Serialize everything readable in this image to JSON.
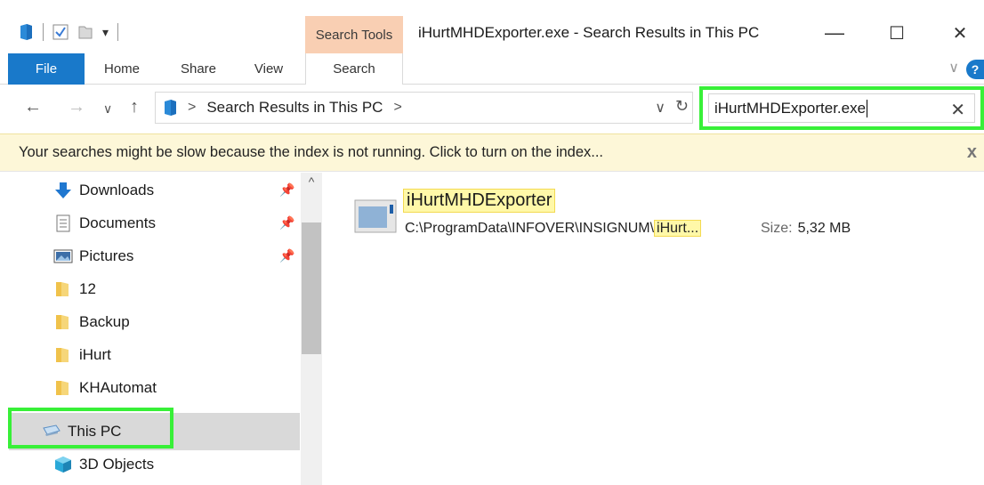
{
  "window": {
    "title": "iHurtMHDExporter.exe - Search Results in This PC",
    "minimize": "—",
    "maximize": "☐",
    "close": "✕"
  },
  "ribbon": {
    "context_group": "Search Tools",
    "tabs": [
      "File",
      "Home",
      "Share",
      "View",
      "Search"
    ],
    "collapse": "∨",
    "help": "?"
  },
  "address": {
    "separator": ">",
    "location": "Search Results in This PC",
    "trailing_separator": ">",
    "dropdown": "∨",
    "refresh": "↻"
  },
  "nav_buttons": {
    "back": "←",
    "forward": "→",
    "recent": "∨",
    "up": "↑"
  },
  "search": {
    "value": "iHurtMHDExporter.exe",
    "clear": "✕"
  },
  "infobar": {
    "text": "Your searches might be slow because the index is not running.  Click to turn on the index...",
    "close": "x"
  },
  "nav_pane": {
    "items": [
      {
        "label": "Downloads",
        "icon": "download-arrow-icon",
        "pinned": true
      },
      {
        "label": "Documents",
        "icon": "documents-icon",
        "pinned": true
      },
      {
        "label": "Pictures",
        "icon": "pictures-icon",
        "pinned": true
      },
      {
        "label": "12",
        "icon": "folder-icon",
        "pinned": false
      },
      {
        "label": "Backup",
        "icon": "folder-icon",
        "pinned": false
      },
      {
        "label": "iHurt",
        "icon": "folder-icon",
        "pinned": false
      },
      {
        "label": "KHAutomat",
        "icon": "folder-icon",
        "pinned": false
      },
      {
        "label": "This PC",
        "icon": "computer-icon",
        "pinned": false,
        "selected": true
      },
      {
        "label": "3D Objects",
        "icon": "cube-icon",
        "pinned": false
      }
    ],
    "scroll_up": "^"
  },
  "results": {
    "items": [
      {
        "name": "iHurtMHDExporter",
        "path_prefix": "C:\\ProgramData\\INFOVER\\INSIGNUM\\",
        "path_match": "iHurt...",
        "size_label": "Size:",
        "size_value": "5,32 MB"
      }
    ]
  },
  "colors": {
    "accent": "#1979ca",
    "context_tab": "#f9cfb3",
    "highlight_box": "#38f038",
    "match_highlight": "#fff8a8",
    "infobar_bg": "#fdf7d8"
  }
}
